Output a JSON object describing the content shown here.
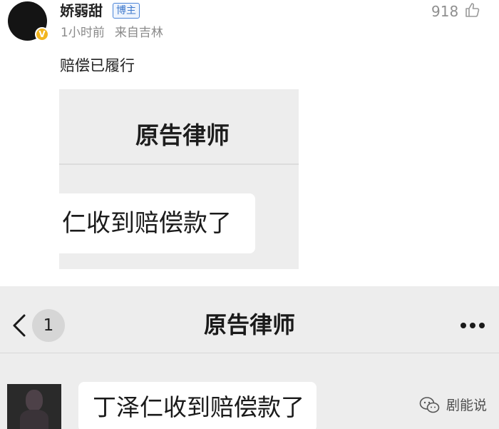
{
  "post": {
    "username": "娇弱甜",
    "blogger_tag": "博主",
    "time": "1小时前",
    "location": "来自吉林",
    "like_count": "918",
    "text": "赔偿已履行",
    "verified_badge": "V",
    "colors": {
      "badge": "#f2b51e",
      "tag": "#3d78cc",
      "meta": "#8a8a8a"
    }
  },
  "screenshot1": {
    "title": "原告律师",
    "bubble_text": "仁收到赔偿款了"
  },
  "screenshot2": {
    "unread_count": "1",
    "title": "原告律师",
    "message": "丁泽仁收到赔偿款了",
    "icons": [
      "back-icon",
      "more-icon"
    ]
  },
  "watermark": {
    "text": "剧能说",
    "icon": "wechat-channel-icon"
  }
}
